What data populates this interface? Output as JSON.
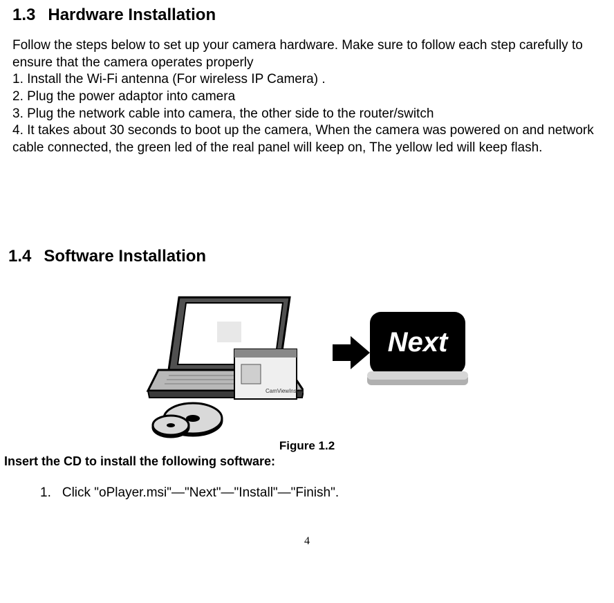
{
  "section13": {
    "number": "1.3",
    "title": "Hardware Installation",
    "intro": "Follow the steps below to set up your camera hardware. Make sure to follow each step carefully to ensure that the camera operates properly",
    "step1": "1. Install the Wi-Fi antenna (For wireless IP Camera) .",
    "step2": "2. Plug the power adaptor into camera",
    "step3": "3. Plug the network cable into camera, the other side to the router/switch",
    "step4": "4. It takes about 30 seconds to boot up the camera, When the camera was powered on and network cable connected, the green led of the real panel will keep on, The yellow led will keep flash."
  },
  "section14": {
    "number": "1.4",
    "title": "Software Installation",
    "figure_caption": "Figure 1.2",
    "insert_cd": "Insert the CD to install the following software:",
    "item1_num": "1.",
    "item1_text": "Click \"oPlayer.msi\"—\"Next\"—\"Install\"—\"Finish\".",
    "next_label": "Next",
    "installer_label": "CamViewInstaller.exe"
  },
  "page_number": "4"
}
